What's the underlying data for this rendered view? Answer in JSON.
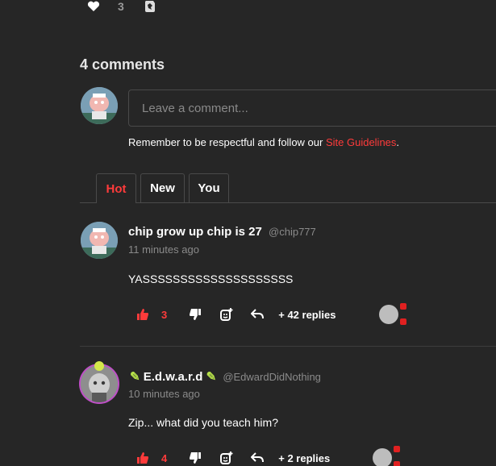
{
  "top": {
    "heart_icon": "heart-icon",
    "like_count": "3",
    "sticker_icon": "sticker-icon"
  },
  "comments_header": {
    "title": "4 comments"
  },
  "composer": {
    "placeholder": "Leave a comment...",
    "guidelines_text": "Remember to be respectful and follow our ",
    "guidelines_link": "Site Guidelines",
    "guidelines_end": "."
  },
  "tabs": [
    {
      "label": "Hot",
      "active": true
    },
    {
      "label": "New",
      "active": false
    },
    {
      "label": "You",
      "active": false
    }
  ],
  "comments": [
    {
      "author": "chip grow up chip is 27",
      "handle": "@chip777",
      "time": "11 minutes ago",
      "body": "YASSSSSSSSSSSSSSSSSSSS",
      "likes": "3",
      "replies": "+ 42 replies"
    },
    {
      "author": "E.d.w.a.r.d",
      "handle": "@EdwardDidNothing",
      "time": "10 minutes ago",
      "body": "Zip... what did you teach him?",
      "likes": "4",
      "replies": "+ 2 replies"
    }
  ],
  "colors": {
    "accent": "#ff3b3b",
    "background": "#262626",
    "muted": "#8a8a8a"
  }
}
